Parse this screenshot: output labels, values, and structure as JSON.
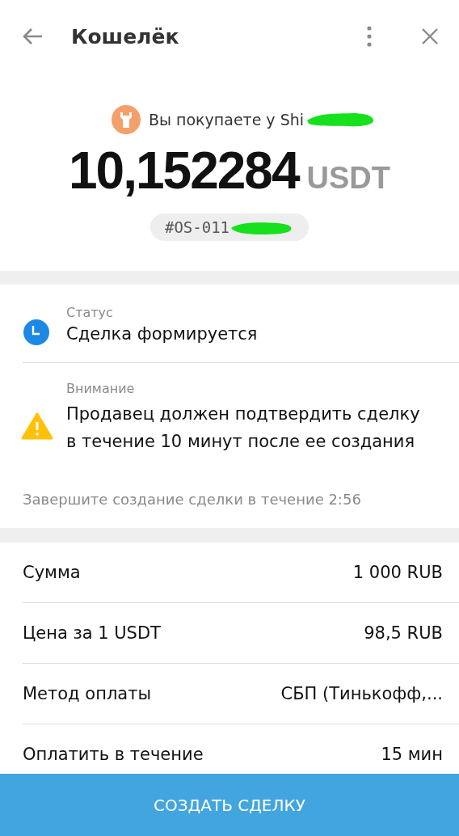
{
  "header": {
    "title": "Кошелёк"
  },
  "offer": {
    "seller_text": "Вы покупаете у Shi",
    "amount": "10,152284",
    "currency": "USDT",
    "order_id": "#OS-011"
  },
  "status": {
    "label": "Статус",
    "value": "Сделка формируется"
  },
  "warning": {
    "label": "Внимание",
    "text": "Продавец должен подтвердить сделку в течение 10 минут после ее создания"
  },
  "timer_text": "Завершите создание сделки в течение 2:56",
  "details": [
    {
      "label": "Сумма",
      "value": "1 000 RUB"
    },
    {
      "label": "Цена за 1 USDT",
      "value": "98,5 RUB"
    },
    {
      "label": "Метод оплаты",
      "value": "СБП (Тинькофф,..."
    },
    {
      "label": "Оплатить в течение",
      "value": "15 мин"
    }
  ],
  "action_button": "СОЗДАТЬ СДЕЛКУ"
}
